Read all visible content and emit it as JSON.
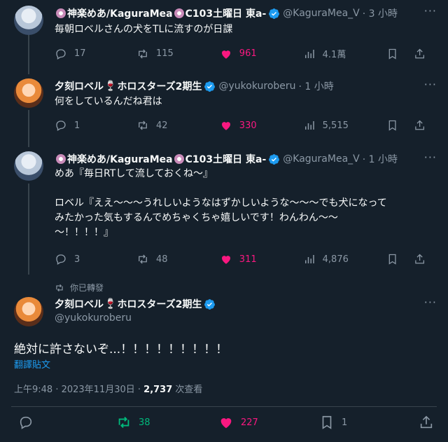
{
  "tweets": [
    {
      "name_pre": "神楽めあ/KaguraMea",
      "name_post": "C103土曜日 東a-",
      "handle": "@KaguraMea_V",
      "time": "· 3 小時",
      "text": "毎朝ロベルさんの犬をTLに流すのが日課",
      "reply_count": "17",
      "retweet_count": "115",
      "like_count": "961",
      "views": "4.1萬"
    },
    {
      "name_pre": "夕刻ロベル",
      "name_post": "ホロスターズ2期生",
      "handle": "@yukokuroberu",
      "time": "· 1 小時",
      "text": "何をしているんだね君は",
      "reply_count": "1",
      "retweet_count": "42",
      "like_count": "330",
      "views": "5,515"
    },
    {
      "name_pre": "神楽めあ/KaguraMea",
      "name_post": "C103土曜日 東a-",
      "handle": "@KaguraMea_V",
      "time": "· 1 小時",
      "text": "めあ『毎日RTして流しておくね～』\n\nロベル『ええ～～～うれしいようなはずかしいような～～～でも犬になって\nみたかった気もするんでめちゃくちゃ嬉しいです！わんわん～～\n～！！！！』",
      "reply_count": "3",
      "retweet_count": "48",
      "like_count": "311",
      "views": "4,876"
    }
  ],
  "main": {
    "retweeted_label": "你已轉發",
    "name_pre": "夕刻ロベル",
    "name_post": "ホロスターズ2期生",
    "handle": "@yukokuroberu",
    "text": "絶対に許さないぞ...！！！！！！！！！",
    "translate": "翻譯貼文",
    "time": "上午9:48 · 2023年11月30日 · ",
    "views": "2,737",
    "views_label": " 次查看",
    "retweet_count": "38",
    "like_count": "227",
    "bookmark_count": "1"
  },
  "icons": {
    "verified": "verified-badge-icon",
    "reply": "reply-icon",
    "retweet": "retweet-icon",
    "like": "heart-icon",
    "views": "analytics-icon",
    "bookmark": "bookmark-icon",
    "share": "share-icon",
    "more": "more-icon"
  },
  "colors": {
    "background": "#15202b",
    "like": "#f91880",
    "retweet": "#00ba7c",
    "link": "#1d9bf0",
    "muted": "#8b98a5"
  }
}
